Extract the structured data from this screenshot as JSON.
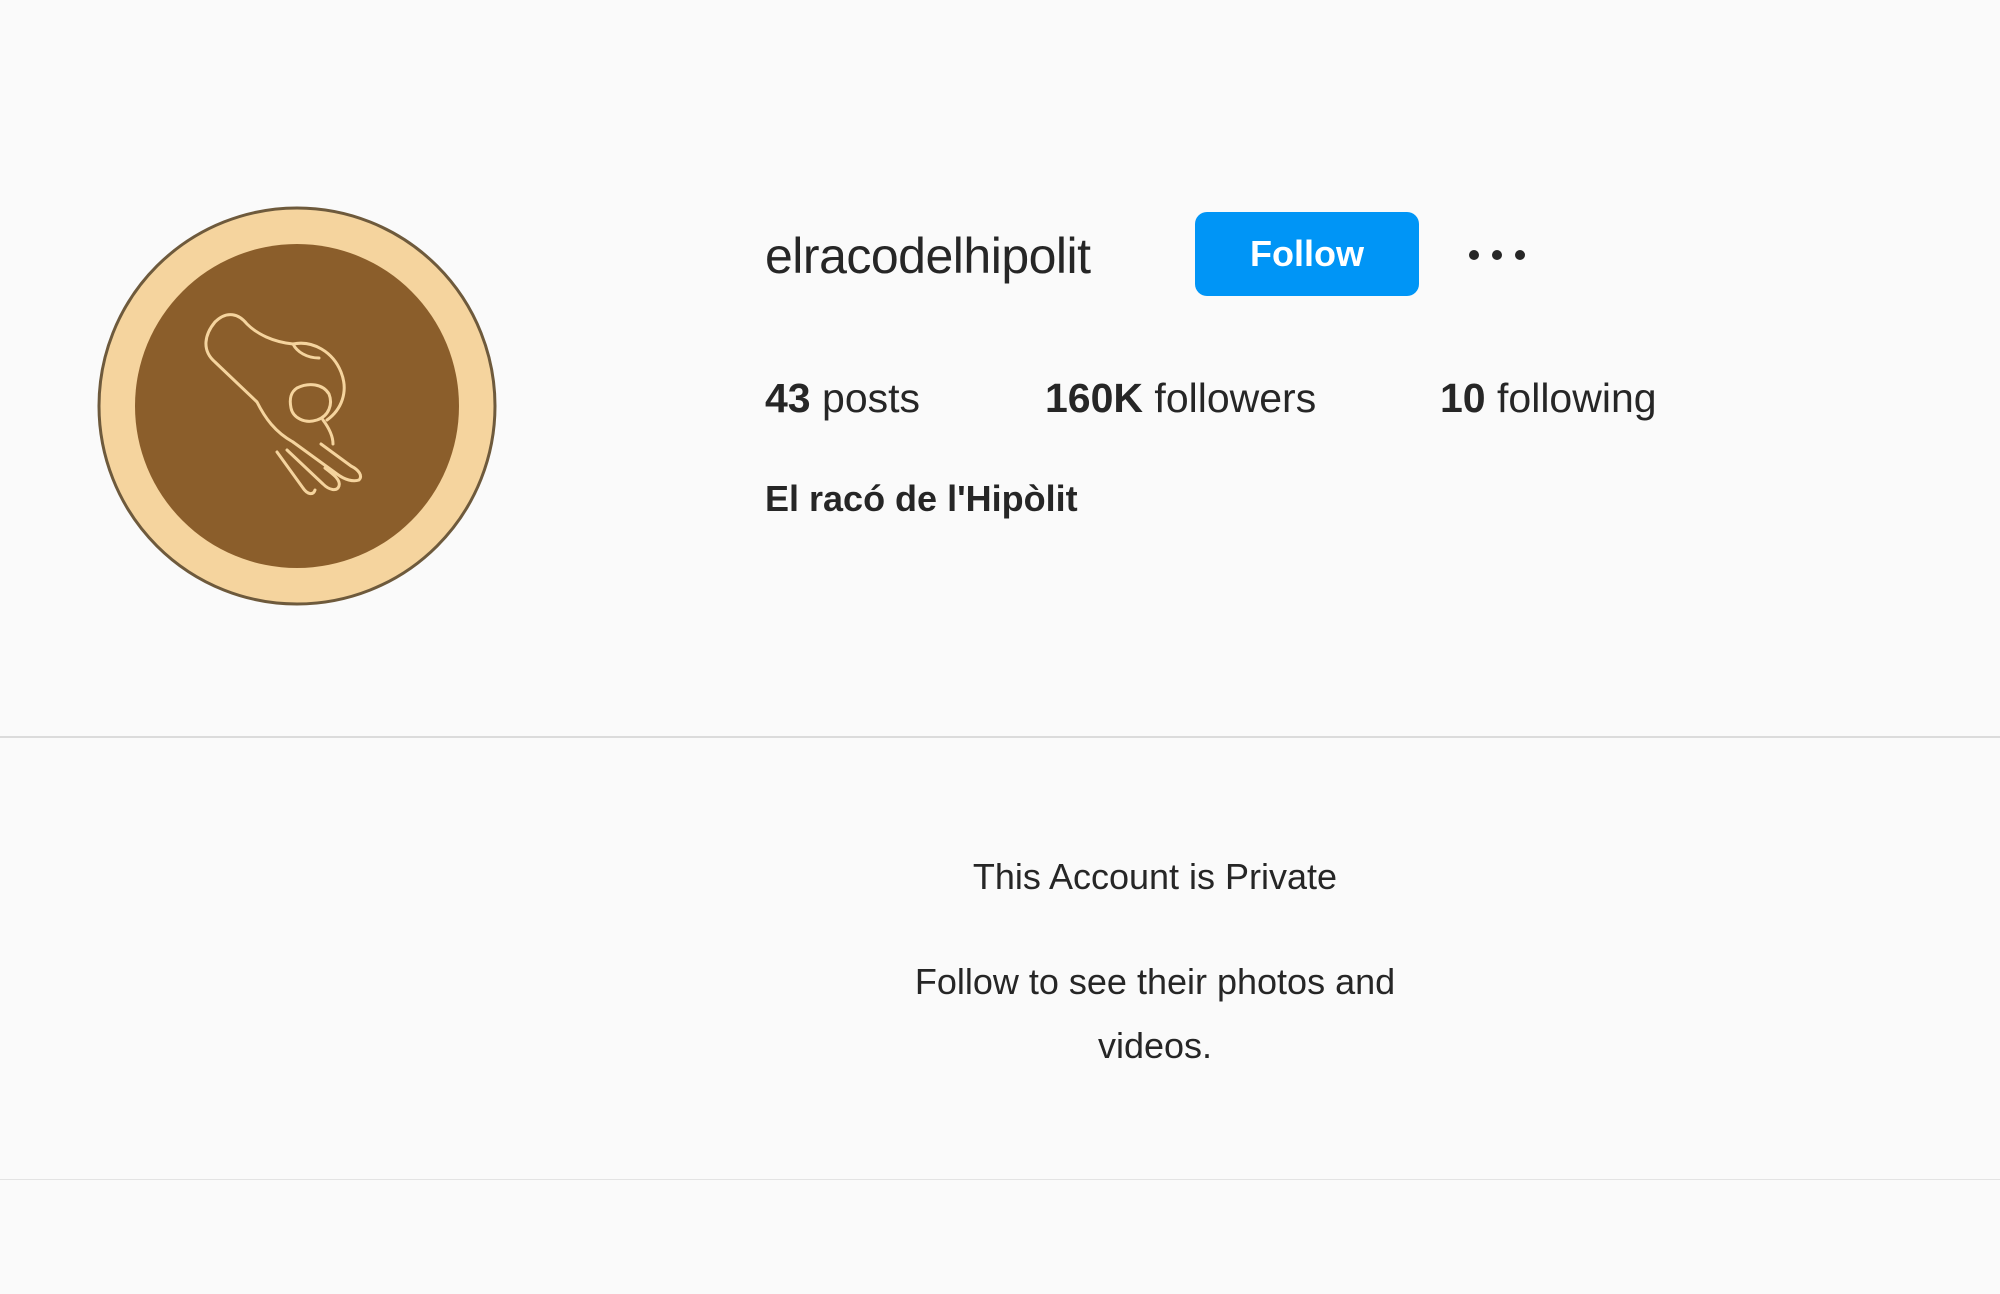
{
  "profile": {
    "username": "elracodelhipolit",
    "full_name": "El racó de l'Hipòlit",
    "avatar_icon": "ok-hand-gesture-icon",
    "follow_label": "Follow",
    "more_icon": "more-options-icon"
  },
  "stats": {
    "posts_count": "43",
    "posts_label": "posts",
    "followers_count": "160K",
    "followers_label": "followers",
    "following_count": "10",
    "following_label": "following"
  },
  "private_notice": {
    "title": "This Account is Private",
    "message": "Follow to see their photos and videos."
  },
  "colors": {
    "accent": "#0095f6",
    "avatar_ring": "#f5d49e",
    "avatar_inner": "#8b5e2b",
    "text": "#262626",
    "divider": "#dbdbdb"
  }
}
